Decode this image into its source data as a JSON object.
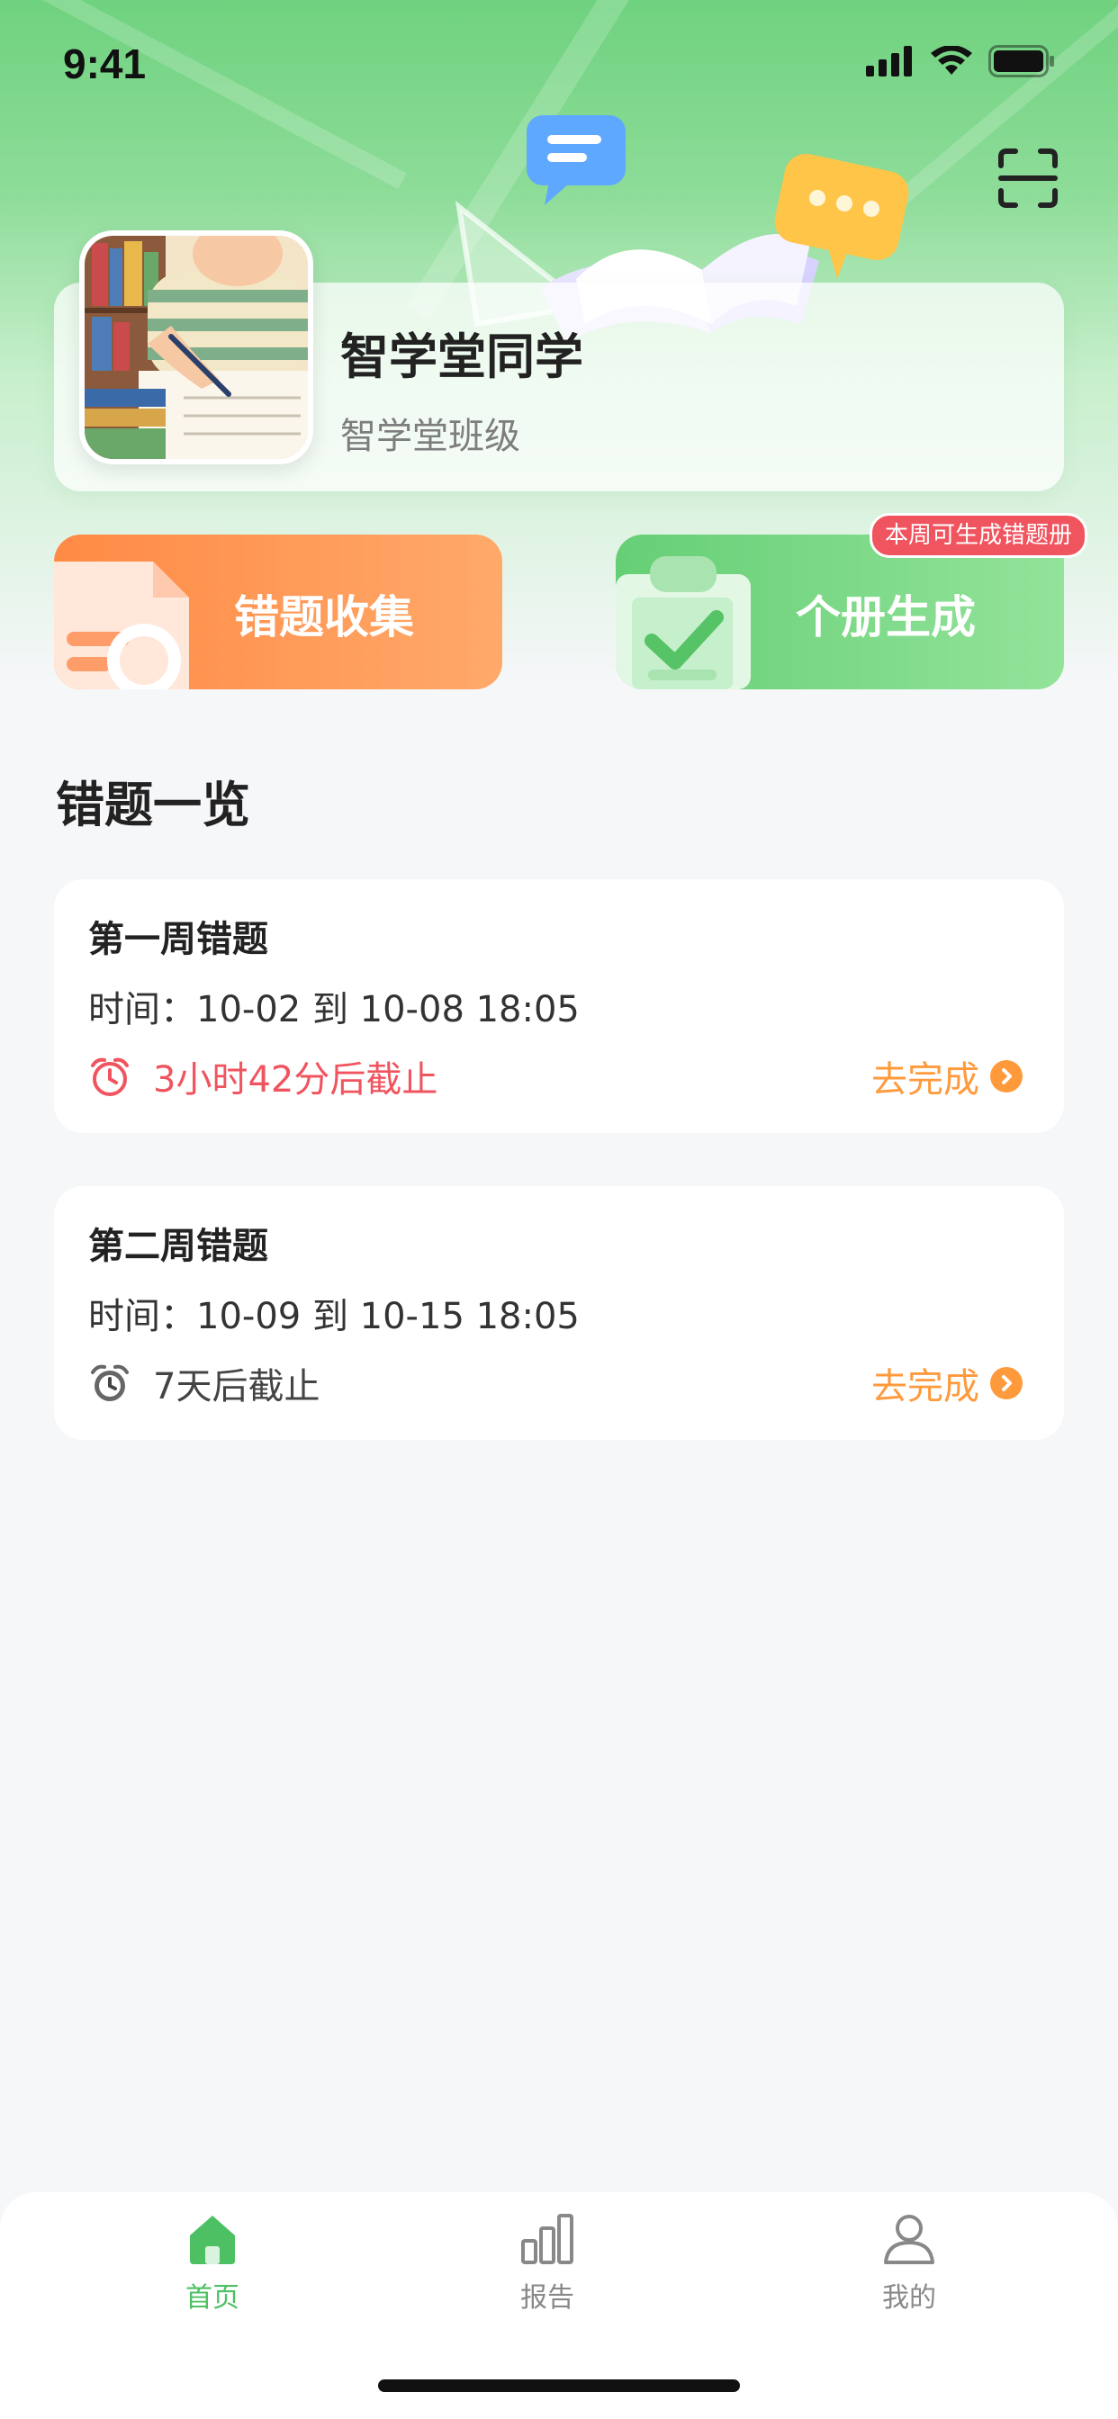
{
  "status_bar": {
    "time": "9:41"
  },
  "profile": {
    "name": "智学堂同学",
    "class_name": "智学堂班级"
  },
  "actions": {
    "collect_label": "错题收集",
    "generate_label": "个册生成",
    "generate_badge": "本周可生成错题册"
  },
  "section": {
    "title": "错题一览"
  },
  "cards": [
    {
      "title": "第一周错题",
      "time": "时间：10-02 到 10-08   18:05",
      "deadline": "3小时42分后截止",
      "deadline_color": "#f0545f",
      "action": "去完成"
    },
    {
      "title": "第二周错题",
      "time": "时间：10-09 到 10-15   18:05",
      "deadline": "7天后截止",
      "deadline_color": "#444444",
      "action": "去完成"
    }
  ],
  "tabbar": {
    "items": [
      {
        "label": "首页",
        "icon": "home-icon",
        "active": true
      },
      {
        "label": "报告",
        "icon": "bar-chart-icon",
        "active": false
      },
      {
        "label": "我的",
        "icon": "user-icon",
        "active": false
      }
    ]
  },
  "colors": {
    "brand_green": "#4cc063",
    "orange": "#ff9a3c",
    "red": "#f0545f"
  }
}
